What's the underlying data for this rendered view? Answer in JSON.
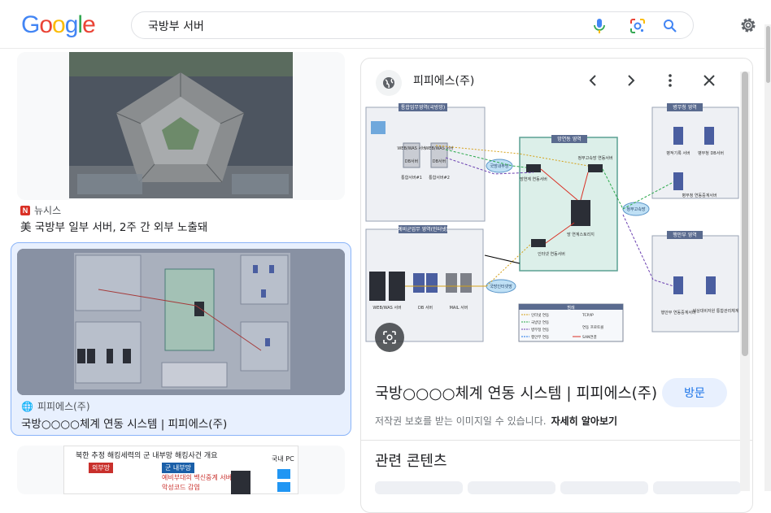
{
  "search": {
    "query": "국방부 서버"
  },
  "logo": [
    "G",
    "o",
    "o",
    "g",
    "l",
    "e"
  ],
  "results": [
    {
      "source": "뉴시스",
      "title": "美 국방부 일부 서버, 2주 간 외부 노출돼"
    },
    {
      "source": "피피에스(주)",
      "title": "국방○○○○체계 연동 시스템 | 피피에스(주)"
    },
    {
      "image_text": [
        "북한 추정 해킹세력의 군 내부망 해킹사건 개요",
        "외부망",
        "군 내부망",
        "국내 PC",
        "예비부대의 백신중계 서버",
        "악성코드 감염"
      ]
    }
  ],
  "panel": {
    "site": "피피에스(주)",
    "title": "국방○○○○체계 연동 시스템 | 피피에스(주)",
    "visit_label": "방문",
    "copyright": "저작권 보호를 받는 이미지일 수 있습니다.",
    "learn_more": "자세히 알아보기",
    "related": "관련 콘텐츠",
    "diagram": {
      "zone_top_left": "통합업무영역(국방망)",
      "zone_bottom_left": "예비군업무 영역(인터넷)",
      "zone_center": "망연동 영역",
      "zone_top_right": "병무청 영역",
      "zone_bottom_right": "행안부 영역",
      "webwas1": "WEB/WAS 서버",
      "db1": "DB서버",
      "integ1": "통합서버#1",
      "webwas2": "WEB/WAS 서버",
      "db2": "DB서버",
      "integ2": "통합서버#2",
      "cloud_defense": "국방내부망",
      "relay_server": "망연계 연동서버",
      "gov_server": "정부고속망 연동서버",
      "internet_relay": "인터넷 연동서버",
      "storage": "망 연계스토리지",
      "cloud_gov": "정부고속망",
      "cloud_internet": "국방인터넷망",
      "mma_record": "병적기록 서버",
      "mma_db": "병무청 DB서버",
      "mma_relay": "병무청 연동중계서버",
      "mois_relay": "행안부 연동중계서버",
      "mois_system": "비상대비자원 통합관리체계",
      "inet_web": "WEB/WAS 서버",
      "inet_db": "DB 서버",
      "inet_mail": "MAIL 서버",
      "legend_title": "범례",
      "legend_items": [
        "인터넷 연동",
        "국방망 연동",
        "병무청 연동",
        "행안부 연동",
        "TCP/IP",
        "연동 프로토콜",
        "SAN연결"
      ]
    }
  }
}
